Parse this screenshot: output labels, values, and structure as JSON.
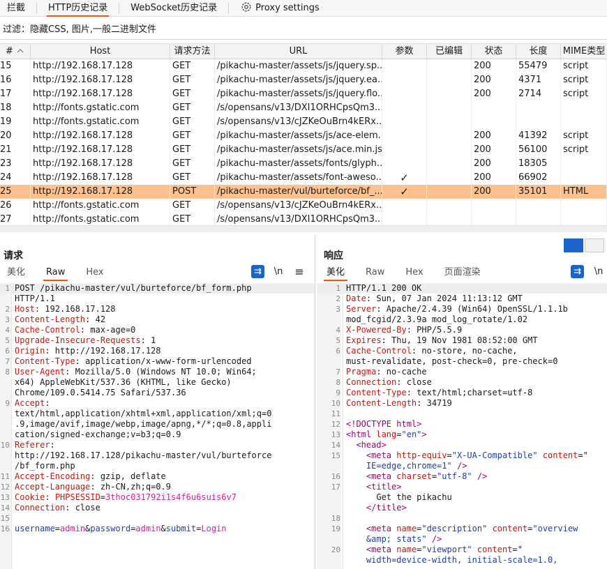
{
  "top_tabs": [
    {
      "label": "拦截",
      "active": false
    },
    {
      "label": "HTTP历史记录",
      "active": true
    },
    {
      "label": "WebSocket历史记录",
      "active": false
    },
    {
      "label": "Proxy settings",
      "active": false
    }
  ],
  "filter": {
    "text": "过滤：隐藏CSS, 图片,一般二进制文件"
  },
  "table": {
    "columns": [
      "#",
      "Host",
      "请求方法",
      "URL",
      "参数",
      "已编辑",
      "状态",
      "长度",
      "MIME类型"
    ],
    "rows": [
      {
        "num": "15",
        "host": "http://192.168.17.128",
        "method": "GET",
        "url": "/pikachu-master/assets/js/jquery.sp...",
        "params": "",
        "edited": "",
        "status": "200",
        "length": "55479",
        "mime": "script"
      },
      {
        "num": "16",
        "host": "http://192.168.17.128",
        "method": "GET",
        "url": "/pikachu-master/assets/js/jquery.ea...",
        "params": "",
        "edited": "",
        "status": "200",
        "length": "4371",
        "mime": "script"
      },
      {
        "num": "17",
        "host": "http://192.168.17.128",
        "method": "GET",
        "url": "/pikachu-master/assets/js/jquery.flo...",
        "params": "",
        "edited": "",
        "status": "200",
        "length": "2714",
        "mime": "script"
      },
      {
        "num": "18",
        "host": "http://fonts.gstatic.com",
        "method": "GET",
        "url": "/s/opensans/v13/DXI1ORHCpsQm3...",
        "params": "",
        "edited": "",
        "status": "",
        "length": "",
        "mime": ""
      },
      {
        "num": "19",
        "host": "http://fonts.gstatic.com",
        "method": "GET",
        "url": "/s/opensans/v13/cJZKeOuBrn4kERx...",
        "params": "",
        "edited": "",
        "status": "",
        "length": "",
        "mime": ""
      },
      {
        "num": "20",
        "host": "http://192.168.17.128",
        "method": "GET",
        "url": "/pikachu-master/assets/js/ace-elem...",
        "params": "",
        "edited": "",
        "status": "200",
        "length": "41392",
        "mime": "script"
      },
      {
        "num": "21",
        "host": "http://192.168.17.128",
        "method": "GET",
        "url": "/pikachu-master/assets/js/ace.min.js",
        "params": "",
        "edited": "",
        "status": "200",
        "length": "56100",
        "mime": "script"
      },
      {
        "num": "23",
        "host": "http://192.168.17.128",
        "method": "GET",
        "url": "/pikachu-master/assets/fonts/glyph...",
        "params": "",
        "edited": "",
        "status": "200",
        "length": "18305",
        "mime": ""
      },
      {
        "num": "24",
        "host": "http://192.168.17.128",
        "method": "GET",
        "url": "/pikachu-master/assets/font-aweso...",
        "params": "✓",
        "edited": "",
        "status": "200",
        "length": "66902",
        "mime": ""
      },
      {
        "num": "25",
        "host": "http://192.168.17.128",
        "method": "POST",
        "url": "/pikachu-master/vul/burteforce/bf_...",
        "params": "✓",
        "edited": "",
        "status": "200",
        "length": "35101",
        "mime": "HTML",
        "selected": true
      },
      {
        "num": "26",
        "host": "http://fonts.gstatic.com",
        "method": "GET",
        "url": "/s/opensans/v13/cJZKeOuBrn4kERx...",
        "params": "",
        "edited": "",
        "status": "",
        "length": "",
        "mime": ""
      },
      {
        "num": "27",
        "host": "http://fonts.gstatic.com",
        "method": "GET",
        "url": "/s/opensans/v13/DXI1ORHCpsQm3...",
        "params": "",
        "edited": "",
        "status": "",
        "length": "",
        "mime": ""
      }
    ]
  },
  "request": {
    "title": "请求",
    "tabs": [
      "美化",
      "Raw",
      "Hex"
    ],
    "active_tab": "Raw",
    "tools": {
      "newline": "\\n",
      "menu": "≡"
    },
    "lines": [
      {
        "n": "1",
        "parts": [
          [
            "v",
            "POST /pikachu-master/vul/burteforce/bf_form.php"
          ]
        ],
        "hl": true
      },
      {
        "n": "",
        "parts": [
          [
            "v",
            "HTTP/1.1"
          ]
        ]
      },
      {
        "n": "2",
        "parts": [
          [
            "k",
            "Host"
          ],
          [
            "v",
            ": 192.168.17.128"
          ]
        ]
      },
      {
        "n": "3",
        "parts": [
          [
            "k",
            "Content-Length"
          ],
          [
            "v",
            ": 42"
          ]
        ]
      },
      {
        "n": "4",
        "parts": [
          [
            "k",
            "Cache-Control"
          ],
          [
            "v",
            ": max-age=0"
          ]
        ]
      },
      {
        "n": "5",
        "parts": [
          [
            "k",
            "Upgrade-Insecure-Requests"
          ],
          [
            "v",
            ": 1"
          ]
        ]
      },
      {
        "n": "6",
        "parts": [
          [
            "k",
            "Origin"
          ],
          [
            "v",
            ": http://192.168.17.128"
          ]
        ]
      },
      {
        "n": "7",
        "parts": [
          [
            "k",
            "Content-Type"
          ],
          [
            "v",
            ": application/x-www-form-urlencoded"
          ]
        ]
      },
      {
        "n": "8",
        "parts": [
          [
            "k",
            "User-Agent"
          ],
          [
            "v",
            ": Mozilla/5.0 (Windows NT 10.0; Win64;"
          ]
        ]
      },
      {
        "n": "",
        "parts": [
          [
            "v",
            "x64) AppleWebKit/537.36 (KHTML, like Gecko)"
          ]
        ]
      },
      {
        "n": "",
        "parts": [
          [
            "v",
            "Chrome/109.0.5414.75 Safari/537.36"
          ]
        ]
      },
      {
        "n": "9",
        "parts": [
          [
            "k",
            "Accept"
          ],
          [
            "v",
            ":"
          ]
        ]
      },
      {
        "n": "",
        "parts": [
          [
            "v",
            "text/html,application/xhtml+xml,application/xml;q=0"
          ]
        ]
      },
      {
        "n": "",
        "parts": [
          [
            "v",
            ".9,image/avif,image/webp,image/apng,*/*;q=0.8,appli"
          ]
        ]
      },
      {
        "n": "",
        "parts": [
          [
            "v",
            "cation/signed-exchange;v=b3;q=0.9"
          ]
        ]
      },
      {
        "n": "10",
        "parts": [
          [
            "k",
            "Referer"
          ],
          [
            "v",
            ":"
          ]
        ]
      },
      {
        "n": "",
        "parts": [
          [
            "v",
            "http://192.168.17.128/pikachu-master/vul/burteforce"
          ]
        ]
      },
      {
        "n": "",
        "parts": [
          [
            "v",
            "/bf_form.php"
          ]
        ]
      },
      {
        "n": "11",
        "parts": [
          [
            "k",
            "Accept-Encoding"
          ],
          [
            "v",
            ": gzip, deflate"
          ]
        ]
      },
      {
        "n": "12",
        "parts": [
          [
            "k",
            "Accept-Language"
          ],
          [
            "v",
            ": zh-CN,zh;q=0.9"
          ]
        ]
      },
      {
        "n": "13",
        "parts": [
          [
            "k",
            "Cookie"
          ],
          [
            "v",
            ": "
          ],
          [
            "k",
            "PHPSESSID"
          ],
          [
            "v",
            "="
          ],
          [
            "pv",
            "3thoc031792i1s4f6u6suis6v7"
          ]
        ]
      },
      {
        "n": "14",
        "parts": [
          [
            "k",
            "Connection"
          ],
          [
            "v",
            ": close"
          ]
        ]
      },
      {
        "n": "15",
        "parts": [
          [
            "v",
            ""
          ]
        ]
      },
      {
        "n": "16",
        "parts": [
          [
            "str",
            "username"
          ],
          [
            "v",
            "="
          ],
          [
            "pv",
            "admin"
          ],
          [
            "v",
            "&"
          ],
          [
            "str",
            "password"
          ],
          [
            "v",
            "="
          ],
          [
            "pv",
            "admin"
          ],
          [
            "v",
            "&"
          ],
          [
            "str",
            "submit"
          ],
          [
            "v",
            "="
          ],
          [
            "pv",
            "Login"
          ]
        ]
      }
    ]
  },
  "response": {
    "title": "响应",
    "tabs": [
      "美化",
      "Raw",
      "Hex",
      "页面渲染"
    ],
    "active_tab": "美化",
    "tools": {
      "newline": "\\n"
    },
    "lines": [
      {
        "n": "1",
        "parts": [
          [
            "v",
            "HTTP/1.1 200 OK"
          ]
        ],
        "hl": true
      },
      {
        "n": "2",
        "parts": [
          [
            "k",
            "Date"
          ],
          [
            "v",
            ": Sun, 07 Jan 2024 11:13:12 GMT"
          ]
        ]
      },
      {
        "n": "3",
        "parts": [
          [
            "k",
            "Server"
          ],
          [
            "v",
            ": Apache/2.4.39 (Win64) OpenSSL/1.1.1b"
          ]
        ]
      },
      {
        "n": "",
        "parts": [
          [
            "v",
            "mod_fcgid/2.3.9a mod_log_rotate/1.02"
          ]
        ]
      },
      {
        "n": "4",
        "parts": [
          [
            "k",
            "X-Powered-By"
          ],
          [
            "v",
            ": PHP/5.5.9"
          ]
        ]
      },
      {
        "n": "5",
        "parts": [
          [
            "k",
            "Expires"
          ],
          [
            "v",
            ": Thu, 19 Nov 1981 08:52:00 GMT"
          ]
        ]
      },
      {
        "n": "6",
        "parts": [
          [
            "k",
            "Cache-Control"
          ],
          [
            "v",
            ": no-store, no-cache,"
          ]
        ]
      },
      {
        "n": "",
        "parts": [
          [
            "v",
            "must-revalidate, post-check=0, pre-check=0"
          ]
        ]
      },
      {
        "n": "7",
        "parts": [
          [
            "k",
            "Pragma"
          ],
          [
            "v",
            ": no-cache"
          ]
        ]
      },
      {
        "n": "8",
        "parts": [
          [
            "k",
            "Connection"
          ],
          [
            "v",
            ": close"
          ]
        ]
      },
      {
        "n": "9",
        "parts": [
          [
            "k",
            "Content-Type"
          ],
          [
            "v",
            ": text/html;charset=utf-8"
          ]
        ]
      },
      {
        "n": "10",
        "parts": [
          [
            "k",
            "Content-Length"
          ],
          [
            "v",
            ": 34719"
          ]
        ]
      },
      {
        "n": "11",
        "parts": [
          [
            "v",
            ""
          ]
        ]
      },
      {
        "n": "12",
        "parts": [
          [
            "tag",
            "<!DOCTYPE html>"
          ]
        ]
      },
      {
        "n": "13",
        "parts": [
          [
            "tag",
            "<html "
          ],
          [
            "attr",
            "lang"
          ],
          [
            "v",
            "="
          ],
          [
            "str",
            "\"en\""
          ],
          [
            "tag",
            ">"
          ]
        ]
      },
      {
        "n": "14",
        "parts": [
          [
            "v",
            "  "
          ],
          [
            "tag",
            "<head>"
          ]
        ]
      },
      {
        "n": "15",
        "parts": [
          [
            "v",
            "    "
          ],
          [
            "tag",
            "<meta "
          ],
          [
            "attr",
            "http-equiv"
          ],
          [
            "v",
            "="
          ],
          [
            "str",
            "\"X-UA-Compatible\""
          ],
          [
            "v",
            " "
          ],
          [
            "attr",
            "content"
          ],
          [
            "v",
            "=\""
          ]
        ]
      },
      {
        "n": "",
        "parts": [
          [
            "v",
            "    "
          ],
          [
            "str",
            "IE=edge,chrome=1\""
          ],
          [
            "v",
            " "
          ],
          [
            "tag",
            "/>"
          ]
        ]
      },
      {
        "n": "16",
        "parts": [
          [
            "v",
            "    "
          ],
          [
            "tag",
            "<meta "
          ],
          [
            "attr",
            "charset"
          ],
          [
            "v",
            "="
          ],
          [
            "str",
            "\"utf-8\""
          ],
          [
            "v",
            " "
          ],
          [
            "tag",
            "/>"
          ]
        ]
      },
      {
        "n": "17",
        "parts": [
          [
            "v",
            "    "
          ],
          [
            "tag",
            "<title>"
          ]
        ]
      },
      {
        "n": "",
        "parts": [
          [
            "v",
            "      Get the pikachu"
          ]
        ]
      },
      {
        "n": "",
        "parts": [
          [
            "v",
            "    "
          ],
          [
            "tag",
            "</title>"
          ]
        ]
      },
      {
        "n": "18",
        "parts": [
          [
            "v",
            ""
          ]
        ]
      },
      {
        "n": "19",
        "parts": [
          [
            "v",
            "    "
          ],
          [
            "tag",
            "<meta "
          ],
          [
            "attr",
            "name"
          ],
          [
            "v",
            "="
          ],
          [
            "str",
            "\"description\""
          ],
          [
            "v",
            " "
          ],
          [
            "attr",
            "content"
          ],
          [
            "v",
            "="
          ],
          [
            "str",
            "\"overview"
          ]
        ]
      },
      {
        "n": "",
        "parts": [
          [
            "v",
            "    "
          ],
          [
            "str",
            "&amp; stats\""
          ],
          [
            "v",
            " "
          ],
          [
            "tag",
            "/>"
          ]
        ]
      },
      {
        "n": "20",
        "parts": [
          [
            "v",
            "    "
          ],
          [
            "tag",
            "<meta "
          ],
          [
            "attr",
            "name"
          ],
          [
            "v",
            "="
          ],
          [
            "str",
            "\"viewport\""
          ],
          [
            "v",
            " "
          ],
          [
            "attr",
            "content"
          ],
          [
            "v",
            "=\""
          ]
        ]
      },
      {
        "n": "",
        "parts": [
          [
            "v",
            "    "
          ],
          [
            "str",
            "width=device-width, initial-scale=1.0,"
          ]
        ]
      }
    ]
  },
  "colors": {
    "accent": "#e8590c",
    "selected_row": "#fdc18f",
    "button_blue": "#1c64c8"
  }
}
